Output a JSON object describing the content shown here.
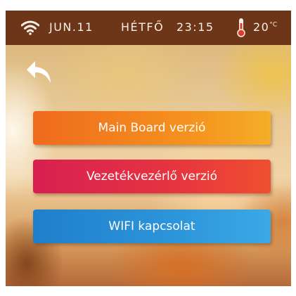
{
  "status_bar": {
    "wifi_icon": "wifi-icon",
    "date": "JUN.11",
    "day": "HÉTFŐ",
    "time": "23:15",
    "thermometer_icon": "thermometer-icon",
    "temperature": "20",
    "temperature_unit": "°C"
  },
  "navigation": {
    "back_icon": "back-arrow-icon"
  },
  "menu": {
    "items": [
      {
        "label": "Main Board verzió",
        "color": "#f0821d"
      },
      {
        "label": "Vezetékvezérlő verzió",
        "color": "#e0304a"
      },
      {
        "label": "WIFI kapcsolat",
        "color": "#2a8fd6"
      }
    ]
  }
}
